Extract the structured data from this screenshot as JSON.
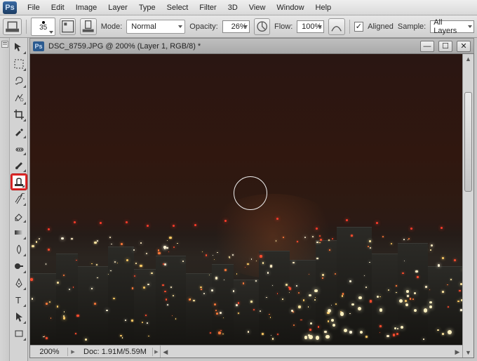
{
  "app": "Ps",
  "menu": [
    "File",
    "Edit",
    "Image",
    "Layer",
    "Type",
    "Select",
    "Filter",
    "3D",
    "View",
    "Window",
    "Help"
  ],
  "options": {
    "brush_size": "35",
    "mode_label": "Mode:",
    "mode_value": "Normal",
    "opacity_label": "Opacity:",
    "opacity_value": "26%",
    "flow_label": "Flow:",
    "flow_value": "100%",
    "aligned_label": "Aligned",
    "aligned_checked": "✓",
    "sample_label": "Sample:",
    "sample_value": "All Layers"
  },
  "document": {
    "title": "DSC_8759.JPG @ 200% (Layer 1, RGB/8) *",
    "zoom": "200%",
    "doc_label": "Doc:",
    "doc_size": "1.91M/5.59M"
  },
  "win_buttons": {
    "min": "—",
    "max": "☐",
    "close": "✕"
  },
  "tools": [
    {
      "name": "move-tool"
    },
    {
      "name": "marquee-tool"
    },
    {
      "name": "lasso-tool"
    },
    {
      "name": "quick-select-tool"
    },
    {
      "name": "crop-tool"
    },
    {
      "name": "eyedropper-tool"
    },
    {
      "name": "spot-heal-tool"
    },
    {
      "name": "brush-tool"
    },
    {
      "name": "clone-stamp-tool",
      "selected": true
    },
    {
      "name": "history-brush-tool"
    },
    {
      "name": "eraser-tool"
    },
    {
      "name": "gradient-tool"
    },
    {
      "name": "blur-tool"
    },
    {
      "name": "dodge-tool"
    },
    {
      "name": "pen-tool"
    },
    {
      "name": "type-tool"
    },
    {
      "name": "path-select-tool"
    },
    {
      "name": "rectangle-tool"
    }
  ]
}
